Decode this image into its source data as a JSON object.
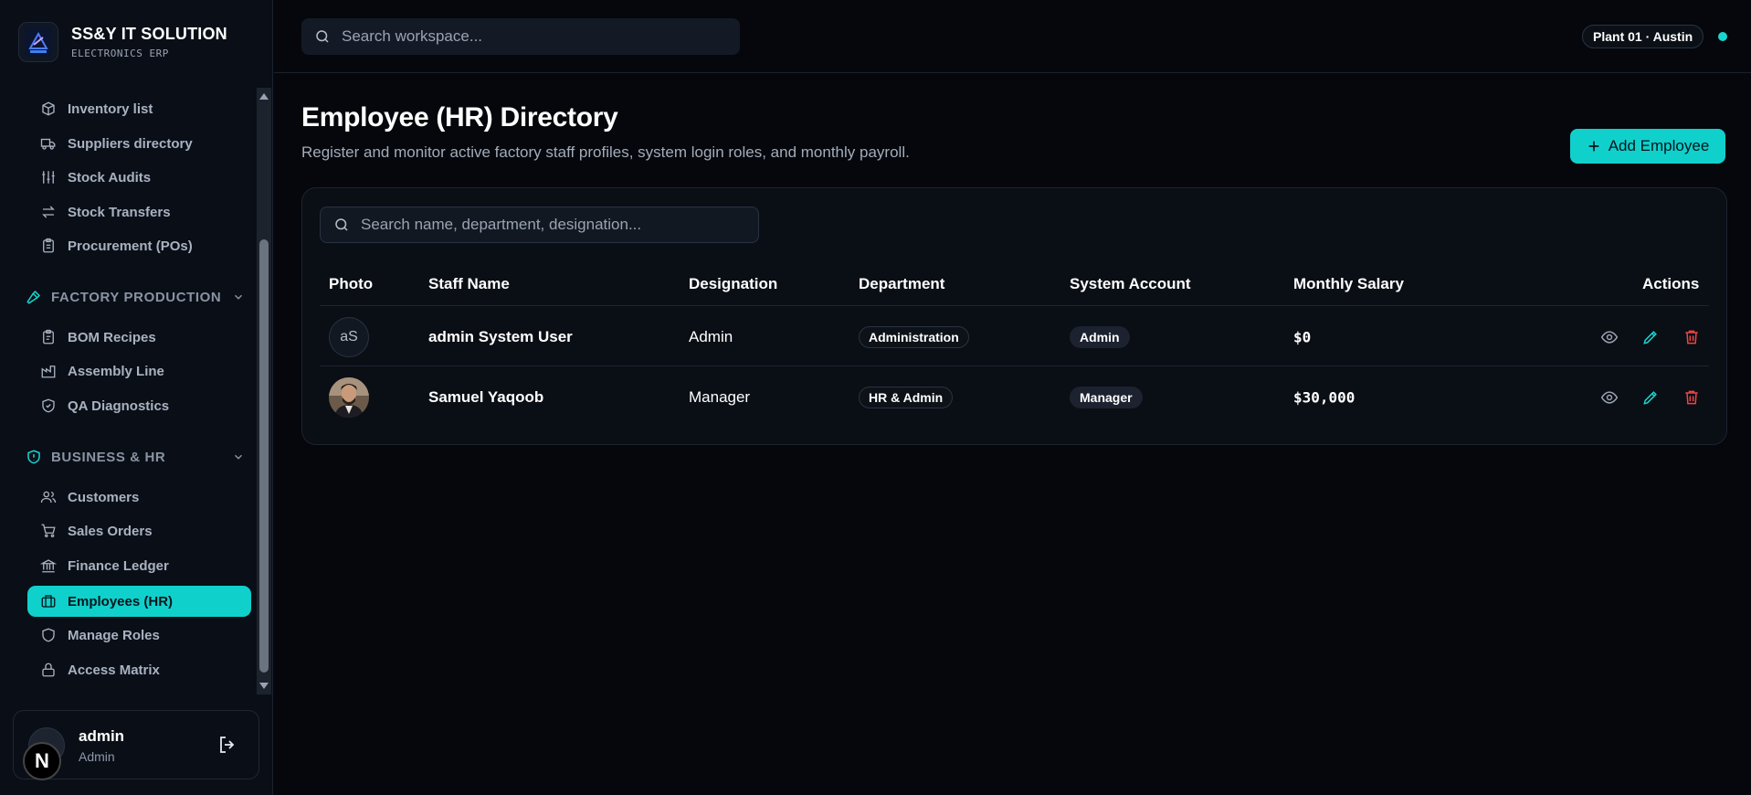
{
  "brand": {
    "name": "SS&Y IT SOLUTION",
    "subtitle": "ELECTRONICS ERP"
  },
  "sidebar": {
    "items_top": [
      {
        "label": "Inventory list",
        "icon": "boxes-icon"
      },
      {
        "label": "Suppliers directory",
        "icon": "truck-icon"
      },
      {
        "label": "Stock Audits",
        "icon": "sliders-icon"
      },
      {
        "label": "Stock Transfers",
        "icon": "arrows-swap-icon"
      },
      {
        "label": "Procurement (POs)",
        "icon": "clipboard-icon"
      }
    ],
    "group_factory": "FACTORY PRODUCTION",
    "items_factory": [
      {
        "label": "BOM Recipes",
        "icon": "clipboard-list-icon"
      },
      {
        "label": "Assembly Line",
        "icon": "factory-icon"
      },
      {
        "label": "QA Diagnostics",
        "icon": "shield-check-icon"
      }
    ],
    "group_business": "BUSINESS & HR",
    "items_business": [
      {
        "label": "Customers",
        "icon": "users-icon"
      },
      {
        "label": "Sales Orders",
        "icon": "cart-icon"
      },
      {
        "label": "Finance Ledger",
        "icon": "bank-icon"
      },
      {
        "label": "Employees (HR)",
        "icon": "briefcase-icon",
        "active": true
      },
      {
        "label": "Manage Roles",
        "icon": "shield-icon"
      },
      {
        "label": "Access Matrix",
        "icon": "lock-icon"
      }
    ]
  },
  "user": {
    "name": "admin",
    "role": "Admin",
    "badge": "N"
  },
  "topbar": {
    "search_placeholder": "Search workspace...",
    "plant": "Plant 01 · Austin"
  },
  "page": {
    "title": "Employee (HR) Directory",
    "subtitle": "Register and monitor active factory staff profiles, system login roles, and monthly payroll.",
    "add_button": "Add Employee"
  },
  "table": {
    "search_placeholder": "Search name, department, designation...",
    "headers": [
      "Photo",
      "Staff Name",
      "Designation",
      "Department",
      "System Account",
      "Monthly Salary",
      "Actions"
    ],
    "rows": [
      {
        "initials": "aS",
        "name": "admin System User",
        "designation": "Admin",
        "department": "Administration",
        "account": "Admin",
        "salary": "$0"
      },
      {
        "initials": "",
        "name": "Samuel Yaqoob",
        "designation": "Manager",
        "department": "HR & Admin",
        "account": "Manager",
        "salary": "$30,000"
      }
    ]
  },
  "colors": {
    "accent": "#10d0cc",
    "danger": "#ef4444",
    "background": "#05070c"
  }
}
